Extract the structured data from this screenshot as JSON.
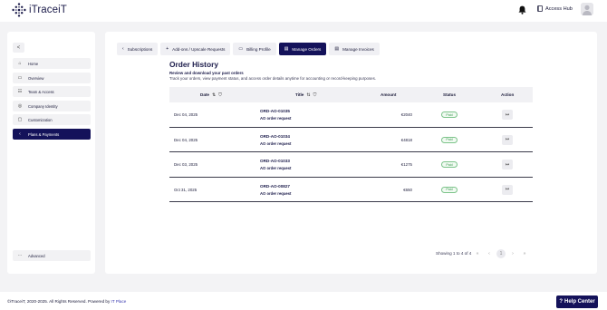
{
  "header": {
    "logo_text": "iTraceiT",
    "access_hub_label": "Access Hub",
    "icons": {
      "logo": "itraceit-logo-icon",
      "notifications": "bell-icon",
      "access_hub": "book-icon",
      "profile": "avatar"
    }
  },
  "sidebar": {
    "collapse_label": "<",
    "items": [
      {
        "label": "Home",
        "icon": "home-icon",
        "glyph": "⌂"
      },
      {
        "label": "Overview",
        "icon": "overview-icon",
        "glyph": "▭"
      },
      {
        "label": "Team & Access",
        "icon": "team-icon",
        "glyph": "☷"
      },
      {
        "label": "Company Identity",
        "icon": "identity-icon",
        "glyph": "◎"
      },
      {
        "label": "Customization",
        "icon": "customization-icon",
        "glyph": "▢"
      },
      {
        "label": "Plans & Payments",
        "icon": "chevron-left-icon",
        "glyph": "‹",
        "active": true
      }
    ],
    "advanced_label": "Advanced",
    "advanced_glyph": "⋯"
  },
  "tabs": [
    {
      "label": "Subscriptions",
      "glyph": "‹"
    },
    {
      "label": "Add-ons / Upscale Requests",
      "glyph": "+"
    },
    {
      "label": "Billing Profile",
      "glyph": "▭"
    },
    {
      "label": "Manage Orders",
      "glyph": "▤",
      "active": true
    },
    {
      "label": "Manage Invoices",
      "glyph": "▤"
    }
  ],
  "orders": {
    "title": "Order History",
    "subtitle": "Review and download your past orders",
    "description": "Track your orders, view payment status, and access order details anytime for accounting or record-keeping purposes.",
    "columns": {
      "date": "Date",
      "title": "Title",
      "amount": "Amount",
      "status": "Status",
      "action": "Action"
    },
    "rows": [
      {
        "date": "Dec 04, 2025",
        "id": "ORD-AO-01035",
        "desc": "AO order request",
        "amount": "€2040",
        "status": "Paid"
      },
      {
        "date": "Dec 04, 2025",
        "id": "ORD-AO-01034",
        "desc": "AO order request",
        "amount": "€4818",
        "status": "Paid"
      },
      {
        "date": "Dec 03, 2025",
        "id": "ORD-AO-01033",
        "desc": "AO order request",
        "amount": "€1275",
        "status": "Paid"
      },
      {
        "date": "Oct 31, 2025",
        "id": "ORD-AO-00827",
        "desc": "AO order request",
        "amount": "€650",
        "status": "Paid"
      }
    ],
    "showing": "Showing 1 to 4 of 4",
    "pagination": {
      "first": "«",
      "prev": "‹",
      "current": "1",
      "next": "›",
      "last": "»"
    }
  },
  "footer": {
    "copyright": "©iTraceiT, 2020-2025. All Rights Reserved. Powered by",
    "powered_by": "IT Place",
    "help_label": "Help Center"
  },
  "colors": {
    "brand": "#14125a",
    "paid_green": "#3f9a52"
  }
}
